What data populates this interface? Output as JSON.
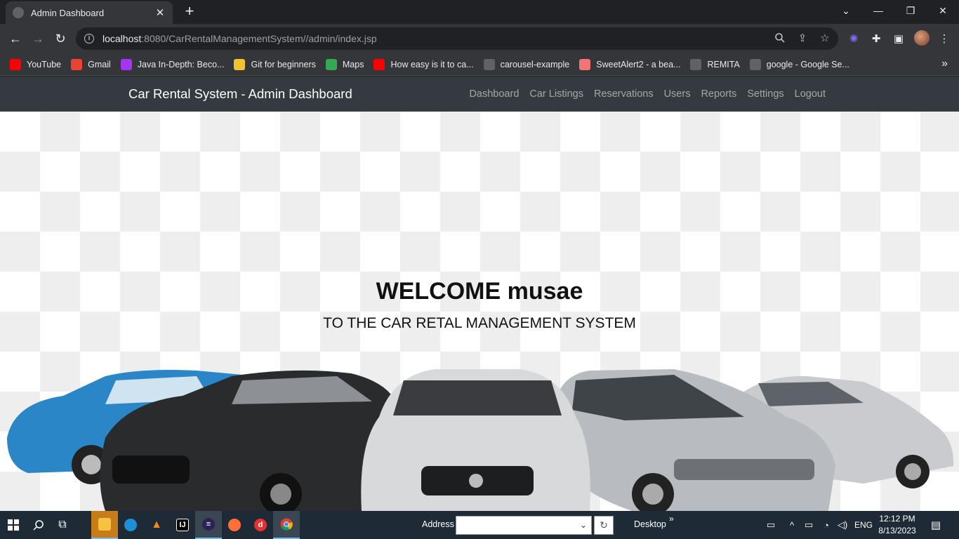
{
  "browser": {
    "tab_title": "Admin Dashboard",
    "url_host": "localhost",
    "url_rest": ":8080/CarRentalManagementSystem//admin/index.jsp"
  },
  "bookmarks": [
    {
      "label": "YouTube",
      "icon": "youtube-icon",
      "color": "#ff0000"
    },
    {
      "label": "Gmail",
      "icon": "gmail-icon",
      "color": "#ea4335"
    },
    {
      "label": "Java In-Depth: Beco...",
      "icon": "udemy-icon",
      "color": "#a435f0"
    },
    {
      "label": "Git for beginners",
      "icon": "git-icon",
      "color": "#f1c232"
    },
    {
      "label": "Maps",
      "icon": "maps-icon",
      "color": "#34a853"
    },
    {
      "label": "How easy is it to ca...",
      "icon": "youtube-icon",
      "color": "#ff0000"
    },
    {
      "label": "carousel-example",
      "icon": "globe-icon",
      "color": "#5f6368"
    },
    {
      "label": "SweetAlert2 - a bea...",
      "icon": "sweetalert-icon",
      "color": "#f27474"
    },
    {
      "label": "REMITA",
      "icon": "globe-icon",
      "color": "#5f6368"
    },
    {
      "label": "google - Google Se...",
      "icon": "globe-icon",
      "color": "#5f6368"
    }
  ],
  "navbar": {
    "brand": "Car Rental System - Admin Dashboard",
    "links": [
      "Dashboard",
      "Car Listings",
      "Reservations",
      "Users",
      "Reports",
      "Settings",
      "Logout"
    ]
  },
  "hero": {
    "welcome": "WELCOME musae",
    "subtitle": "TO THE CAR RETAL MANAGEMENT SYSTEM"
  },
  "taskbar": {
    "address_label": "Address",
    "address_value": "",
    "desktop_label": "Desktop",
    "language": "ENG",
    "time": "12:12 PM",
    "date": "8/13/2023"
  }
}
